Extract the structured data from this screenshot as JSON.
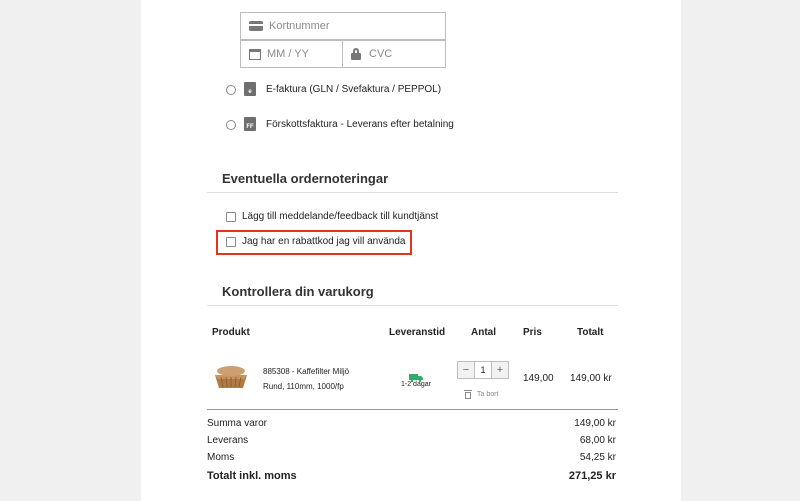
{
  "payment": {
    "card_number_placeholder": "Kortnummer",
    "expiry_placeholder": "MM / YY",
    "cvc_placeholder": "CVC",
    "options": [
      {
        "label": "E-faktura (GLN / Svefaktura / PEPPOL)",
        "icon_text": "e"
      },
      {
        "label": "Förskottsfaktura - Leverans efter betalning",
        "icon_text": "FF"
      }
    ]
  },
  "notes": {
    "title": "Eventuella ordernoteringar",
    "options": [
      "Lägg till meddelande/feedback till kundtjänst",
      "Jag har en rabattkod jag vill använda"
    ]
  },
  "cart": {
    "title": "Kontrollera din varukorg",
    "headers": {
      "product": "Produkt",
      "delivery": "Leveranstid",
      "qty": "Antal",
      "price": "Pris",
      "total": "Totalt"
    },
    "item": {
      "name_line1": "885308 - Kaffefilter Miljö",
      "name_line2": "Rund, 110mm, 1000/fp",
      "delivery": "1-2 dagar",
      "quantity": "1",
      "minus": "−",
      "plus": "+",
      "remove": "Ta bort",
      "price": "149,00",
      "total": "149,00 kr"
    },
    "summary": {
      "subtotal_label": "Summa varor",
      "subtotal_value": "149,00 kr",
      "shipping_label": "Leverans",
      "shipping_value": "68,00 kr",
      "vat_label": "Moms",
      "vat_value": "54,25 kr",
      "total_label": "Totalt inkl. moms",
      "total_value": "271,25 kr"
    }
  },
  "colors": {
    "highlight": "#e53320",
    "delivery_truck": "#2fae6a"
  }
}
